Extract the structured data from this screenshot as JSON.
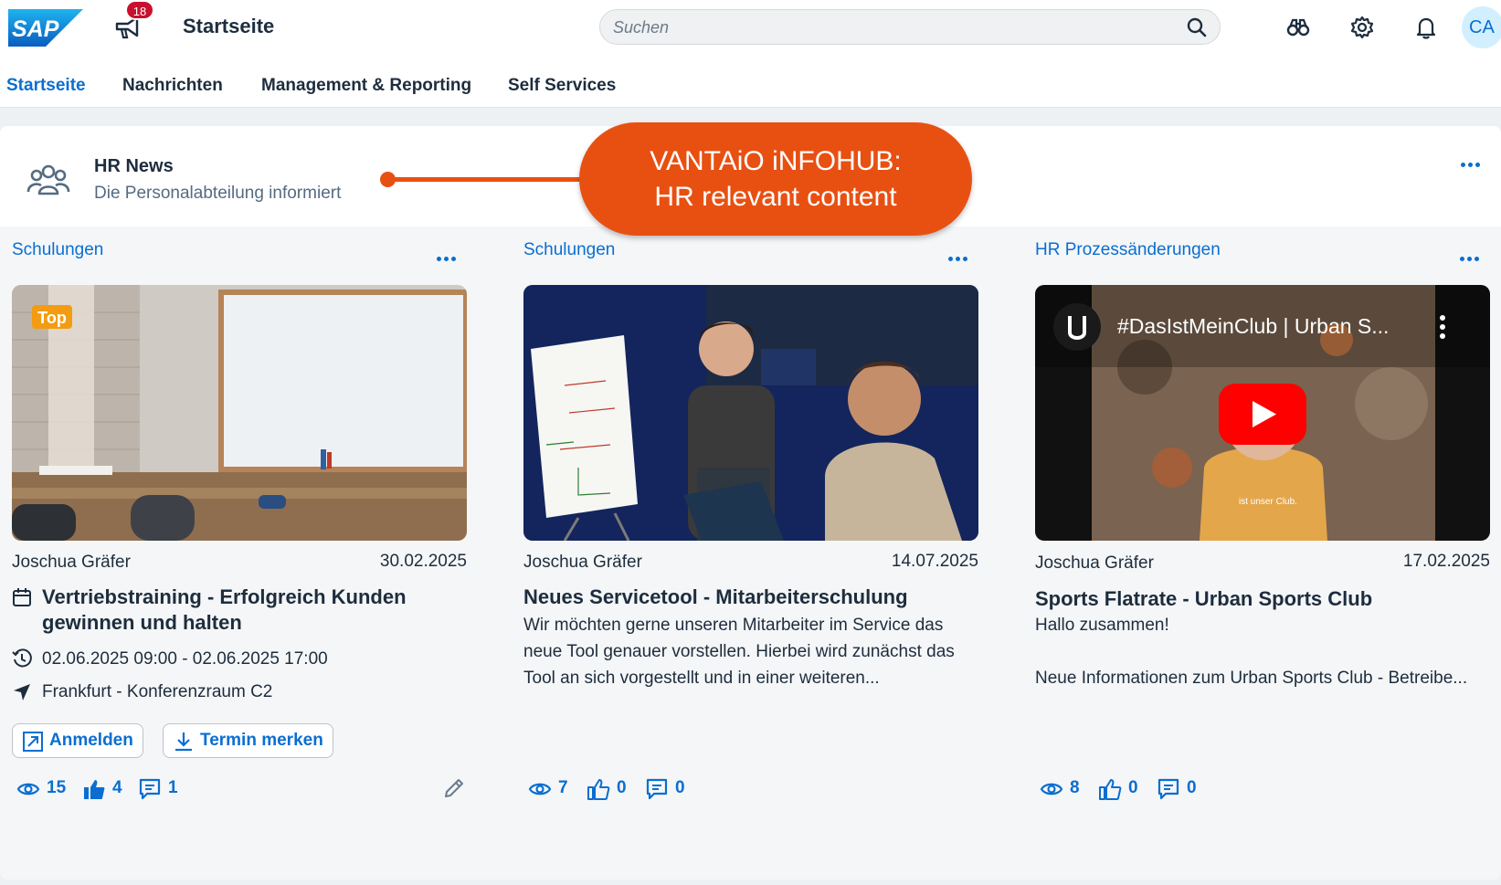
{
  "shell": {
    "logo_text": "SAP",
    "notification_count": "18",
    "title": "Startseite",
    "search_placeholder": "Suchen",
    "avatar_initials": "CA",
    "icons": [
      "announcement-icon",
      "binoculars-icon",
      "gear-icon",
      "bell-icon",
      "search-icon"
    ]
  },
  "nav": {
    "items": [
      {
        "label": "Startseite",
        "active": true
      },
      {
        "label": "Nachrichten",
        "active": false
      },
      {
        "label": "Management & Reporting",
        "active": false
      },
      {
        "label": "Self Services",
        "active": false
      }
    ]
  },
  "hr_news": {
    "title": "HR News",
    "subtitle": "Die Personalabteilung informiert"
  },
  "callout": {
    "line1": "VANTAiO iNFOHUB:",
    "line2": "HR relevant content",
    "color": "#e85012"
  },
  "cards": [
    {
      "category": "Schulungen",
      "badge": "Top",
      "author": "Joschua Gräfer",
      "date": "30.02.2025",
      "title_line1": "Vertriebstraining - Erfolgreich Kunden",
      "title_line2": "gewinnen und halten",
      "time": "02.06.2025 09:00 - 02.06.2025 17:00",
      "location": "Frankfurt - Konferenzraum C2",
      "button_register": "Anmelden",
      "button_save": "Termin merken",
      "views": "15",
      "likes": "4",
      "comments": "1"
    },
    {
      "category": "Schulungen",
      "author": "Joschua Gräfer",
      "date": "14.07.2025",
      "title": "Neues Servicetool - Mitarbeiterschulung",
      "body_line1": "Wir möchten gerne unseren Mitarbeiter im Service das",
      "body_line2": "neue Tool genauer vorstellen. Hierbei wird zunächst das",
      "body_line3": "Tool an sich vorgestellt und in einer weiteren...",
      "views": "7",
      "likes": "0",
      "comments": "0"
    },
    {
      "category": "HR Prozessänderungen",
      "author": "Joschua Gräfer",
      "date": "17.02.2025",
      "title": "Sports Flatrate - Urban Sports Club",
      "video_title": "#DasIstMeinClub | Urban S...",
      "video_caption": "ist unser Club.",
      "body_line1": "Hallo zusammen!",
      "body_line3": "Neue Informationen zum Urban Sports Club - Betreibe...",
      "views": "8",
      "likes": "0",
      "comments": "0"
    }
  ],
  "colors": {
    "accent": "#0a6ed1",
    "badge": "#c8102e",
    "callout": "#e85012",
    "top_badge": "#f39c12"
  }
}
